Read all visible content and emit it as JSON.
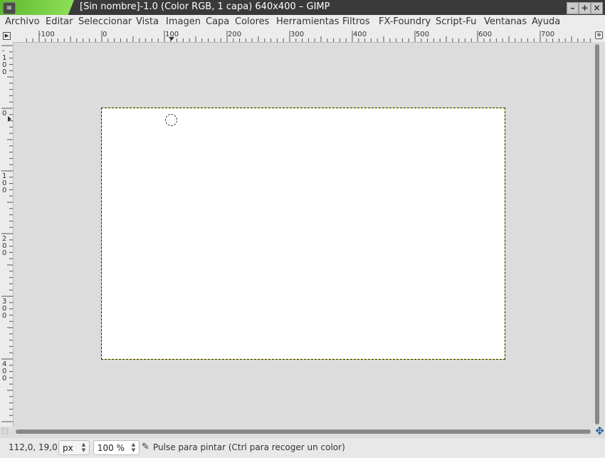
{
  "window": {
    "title": "[Sin nombre]-1.0 (Color RGB, 1 capa) 640x400 – GIMP",
    "app_menu_icon": "menu-icon",
    "minimize": "–",
    "maximize": "+",
    "close": "×"
  },
  "menubar": [
    {
      "label": "Archivo"
    },
    {
      "label": "Editar"
    },
    {
      "label": "Seleccionar"
    },
    {
      "label": "Vista"
    },
    {
      "label": "Imagen"
    },
    {
      "label": "Capa"
    },
    {
      "label": "Colores"
    },
    {
      "label": "Herramientas"
    },
    {
      "label": "Filtros"
    },
    {
      "label": "FX-Foundry"
    },
    {
      "label": "Script-Fu"
    },
    {
      "label": "Ventanas"
    },
    {
      "label": "Ayuda"
    }
  ],
  "rulers": {
    "horizontal_labels": [
      "-100",
      "0",
      "100",
      "200",
      "300",
      "400",
      "500",
      "600",
      "700"
    ],
    "vertical_labels": [
      "-100",
      "0",
      "100",
      "200",
      "300",
      "400"
    ]
  },
  "statusbar": {
    "coords": "112,0, 19,0",
    "unit": "px",
    "zoom": "100 %",
    "message": "Pulse para pintar (Ctrl para recoger un color)"
  },
  "colors": {
    "titlebar": "#3a3a3a",
    "accent_green": "#5fb82f",
    "canvas_background": "#dcdcdc",
    "image_fill": "#ffffff",
    "selection_border": "#e6e600"
  }
}
